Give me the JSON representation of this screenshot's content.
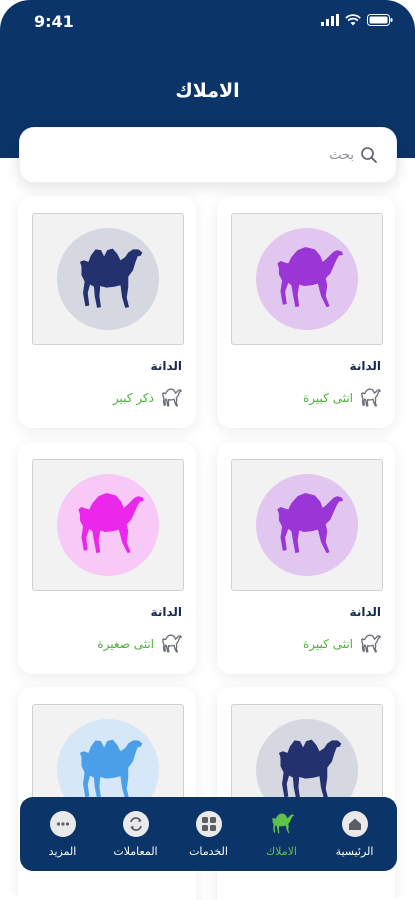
{
  "status": {
    "time": "9:41"
  },
  "header": {
    "title": "الاملاك"
  },
  "search": {
    "placeholder": "بحث"
  },
  "colors": {
    "header_bg": "#0b3468",
    "accent_green": "#4caf3a",
    "camel_navy": "#23316e",
    "camel_purple": "#9a36d6",
    "camel_pink": "#ec27ec",
    "camel_blue": "#4b9fe8"
  },
  "cards": [
    {
      "name": "الدانة",
      "type": "انثى كبيرة",
      "image": "dromedary-camel-purple"
    },
    {
      "name": "الدانة",
      "type": "ذكر كبير",
      "image": "bactrian-camel-navy"
    },
    {
      "name": "الدانة",
      "type": "انثى كبيرة",
      "image": "dromedary-camel-purple"
    },
    {
      "name": "الدانة",
      "type": "انثى صغيرة",
      "image": "dromedary-camel-pink"
    },
    {
      "name": "",
      "type": "",
      "image": "bactrian-camel-navy"
    },
    {
      "name": "",
      "type": "",
      "image": "bactrian-camel-blue"
    }
  ],
  "tabbar": {
    "items": [
      {
        "label": "الرئيسية",
        "icon": "home-icon",
        "active": false
      },
      {
        "label": "الاملاك",
        "icon": "camel-icon",
        "active": true
      },
      {
        "label": "الخدمات",
        "icon": "grid-icon",
        "active": false
      },
      {
        "label": "المعاملات",
        "icon": "swap-icon",
        "active": false
      },
      {
        "label": "المزيد",
        "icon": "more-icon",
        "active": false
      }
    ]
  }
}
